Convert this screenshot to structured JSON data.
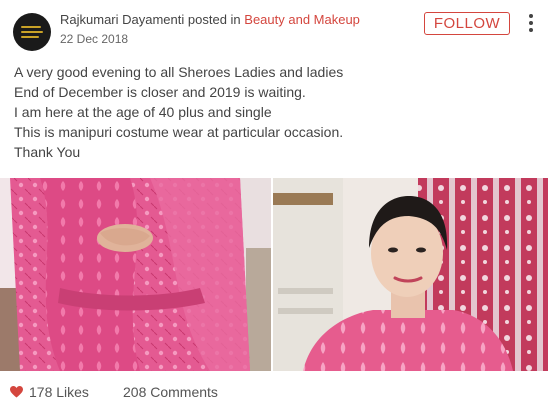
{
  "post": {
    "author": "Rajkumari Dayamenti",
    "posted_in_label": "posted in",
    "category": "Beauty and Makeup",
    "date": "22 Dec 2018",
    "follow_label": "FOLLOW",
    "lines": [
      "A very good evening to all Sheroes Ladies and ladies",
      "End of December is closer and 2019 is waiting.",
      "I am here at the age of 40 plus and single",
      "This is manipuri costume wear at particular occasion.",
      "Thank You"
    ]
  },
  "footer": {
    "likes": "178 Likes",
    "comments": "208 Comments"
  },
  "colors": {
    "accent": "#d4463e",
    "text": "#444444",
    "pink_cloth": "#e8558f",
    "heart": "#d4463e"
  },
  "icons": {
    "more": "more-vertical-icon",
    "like": "heart-icon"
  }
}
